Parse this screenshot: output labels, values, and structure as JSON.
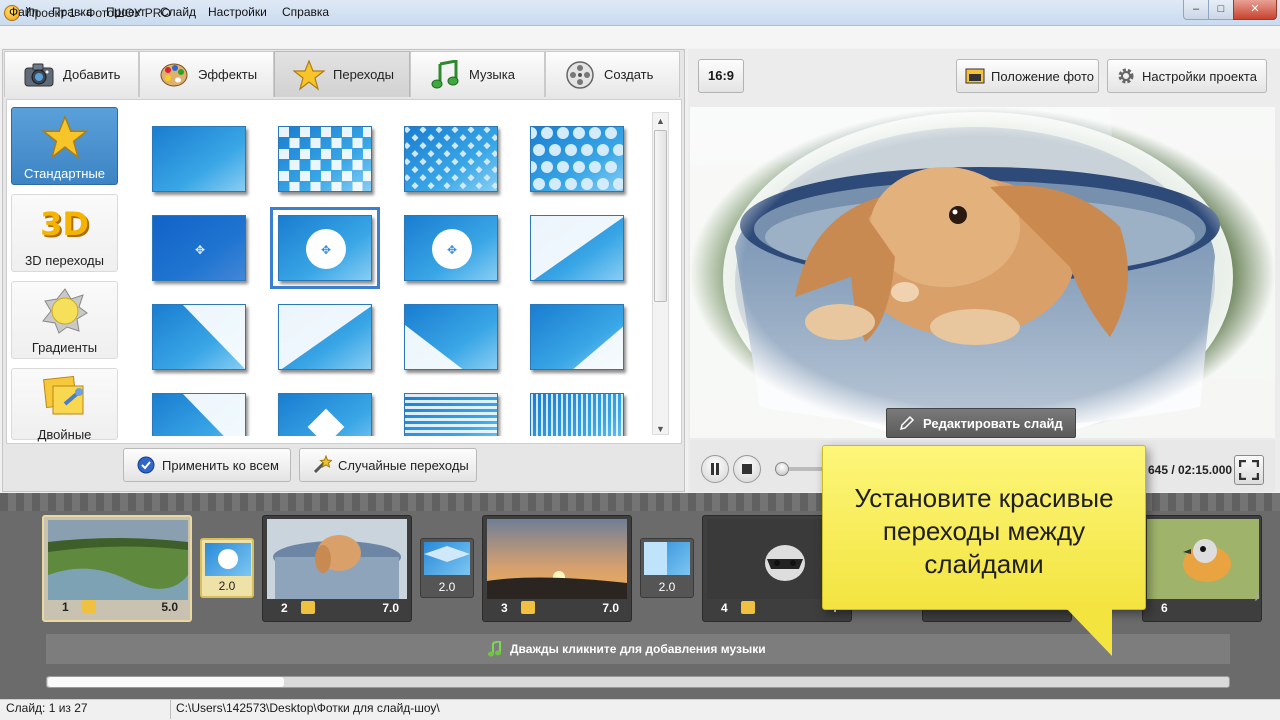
{
  "window": {
    "title": "Проект 1 - ФотоШОУ PRO"
  },
  "menu": [
    "Файл",
    "Правка",
    "Проект",
    "Слайд",
    "Настройки",
    "Справка"
  ],
  "tabs": [
    {
      "label": "Добавить",
      "icon": "camera-icon"
    },
    {
      "label": "Эффекты",
      "icon": "palette-icon"
    },
    {
      "label": "Переходы",
      "icon": "star-icon",
      "active": true
    },
    {
      "label": "Музыка",
      "icon": "music-note-icon"
    },
    {
      "label": "Создать",
      "icon": "film-reel-icon"
    }
  ],
  "categories": [
    {
      "label": "Стандартные",
      "icon": "star-icon",
      "active": true
    },
    {
      "label": "3D переходы",
      "icon": "3d-icon",
      "badge": "3D"
    },
    {
      "label": "Градиенты",
      "icon": "gradient-sun-icon"
    },
    {
      "label": "Двойные",
      "icon": "double-note-icon"
    }
  ],
  "transitions": {
    "selected_index": 5,
    "rows": 4,
    "cols": 4
  },
  "buttons": {
    "apply_all": "Применить ко всем",
    "random": "Случайные переходы"
  },
  "preview": {
    "aspect": "16:9",
    "photo_position": "Положение фото",
    "project_settings": "Настройки проекта",
    "edit_slide": "Редактировать слайд",
    "timecode": "645 / 02:15.000"
  },
  "timeline": {
    "slides": [
      {
        "num": "1",
        "duration": "5.0",
        "selected": true
      },
      {
        "num": "2",
        "duration": "7.0"
      },
      {
        "num": "3",
        "duration": "7.0"
      },
      {
        "num": "4",
        "duration": "7"
      },
      {
        "num": "6",
        "duration": ""
      }
    ],
    "transitions": [
      {
        "duration": "2.0",
        "selected": true
      },
      {
        "duration": "2.0"
      },
      {
        "duration": "2.0"
      }
    ],
    "music_hint": "Дважды кликните для добавления музыки"
  },
  "tooltip": {
    "line1": "Установите красивые",
    "line2": "переходы между",
    "line3": "слайдами"
  },
  "status": {
    "slide": "Слайд: 1 из 27",
    "path": "C:\\Users\\142573\\Desktop\\Фотки для слайд-шоу\\"
  },
  "colors": {
    "accent": "#3d84c4",
    "tooltip": "#f3e440",
    "timeline": "#6b6b6b"
  }
}
